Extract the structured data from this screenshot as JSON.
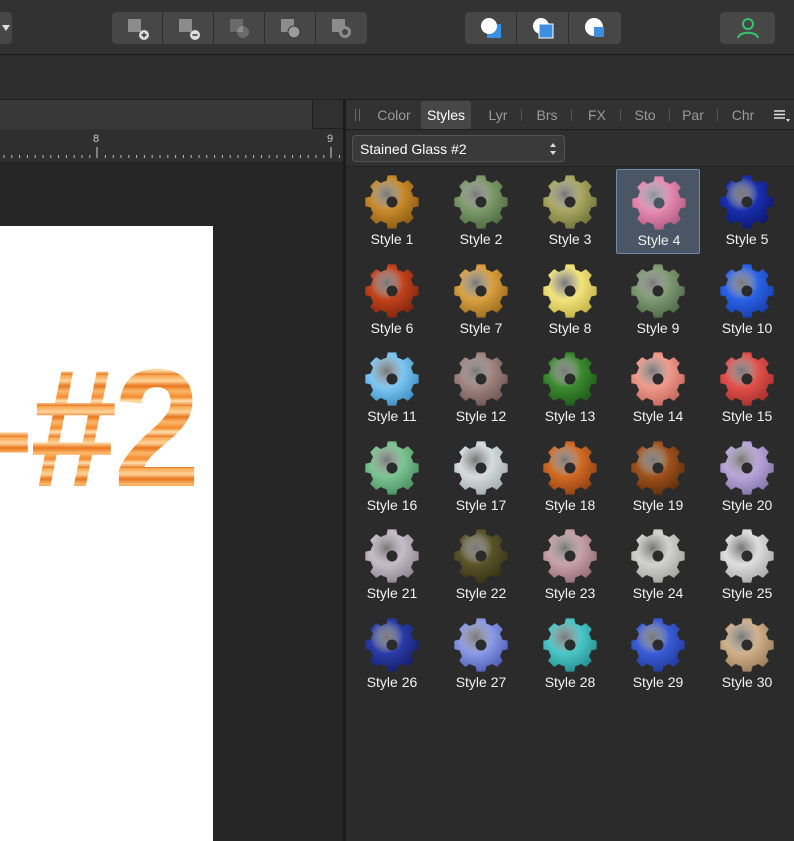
{
  "toolbar": {
    "boolean_ops": [
      "add",
      "subtract",
      "intersect",
      "divide",
      "combine"
    ],
    "shape_ops": [
      "back",
      "front",
      "cut"
    ]
  },
  "ruler": {
    "labels": [
      "8",
      "9"
    ]
  },
  "document": {
    "text": "-#2"
  },
  "panel": {
    "tabs": [
      "Color",
      "Styles",
      "Lyr",
      "Brs",
      "FX",
      "Sto",
      "Par",
      "Chr"
    ],
    "active_tab": "Styles",
    "category": "Stained Glass #2",
    "selected_style": "Style 4",
    "styles": [
      {
        "label": "Style 1",
        "color": "#c98a2a",
        "dark": "#8a5a14"
      },
      {
        "label": "Style 2",
        "color": "#7c9a6a",
        "dark": "#4e6a40"
      },
      {
        "label": "Style 3",
        "color": "#a9a862",
        "dark": "#6f7038"
      },
      {
        "label": "Style 4",
        "color": "#e58ab0",
        "dark": "#b05a80"
      },
      {
        "label": "Style 5",
        "color": "#1a2fb0",
        "dark": "#0c1670"
      },
      {
        "label": "Style 6",
        "color": "#c2421c",
        "dark": "#7e2410"
      },
      {
        "label": "Style 7",
        "color": "#d9a040",
        "dark": "#9a6a1e"
      },
      {
        "label": "Style 8",
        "color": "#f2e37a",
        "dark": "#c0b048"
      },
      {
        "label": "Style 9",
        "color": "#7e9a72",
        "dark": "#4e6848"
      },
      {
        "label": "Style 10",
        "color": "#2a62e8",
        "dark": "#173ea8"
      },
      {
        "label": "Style 11",
        "color": "#7cc6f2",
        "dark": "#3e8ec0"
      },
      {
        "label": "Style 12",
        "color": "#a08480",
        "dark": "#6e5652"
      },
      {
        "label": "Style 13",
        "color": "#3c8a30",
        "dark": "#1f5a18"
      },
      {
        "label": "Style 14",
        "color": "#f09a8a",
        "dark": "#c0685a"
      },
      {
        "label": "Style 15",
        "color": "#e2504a",
        "dark": "#a8302c"
      },
      {
        "label": "Style 16",
        "color": "#7cc492",
        "dark": "#4a8e60"
      },
      {
        "label": "Style 17",
        "color": "#d6dcdc",
        "dark": "#a2aaaa"
      },
      {
        "label": "Style 18",
        "color": "#d26a24",
        "dark": "#8e4012"
      },
      {
        "label": "Style 19",
        "color": "#a0521c",
        "dark": "#5e2e0c"
      },
      {
        "label": "Style 20",
        "color": "#b8a6d8",
        "dark": "#8474a8"
      },
      {
        "label": "Style 21",
        "color": "#c6bcc6",
        "dark": "#8e848e"
      },
      {
        "label": "Style 22",
        "color": "#5a5428",
        "dark": "#363214"
      },
      {
        "label": "Style 23",
        "color": "#c6a0aa",
        "dark": "#946c78"
      },
      {
        "label": "Style 24",
        "color": "#d2d2d0",
        "dark": "#a0a09e"
      },
      {
        "label": "Style 25",
        "color": "#dedede",
        "dark": "#a8a8a8"
      },
      {
        "label": "Style 26",
        "color": "#2a3ca8",
        "dark": "#141e68"
      },
      {
        "label": "Style 27",
        "color": "#8a9ae6",
        "dark": "#4c5cb6"
      },
      {
        "label": "Style 28",
        "color": "#4ac6c6",
        "dark": "#268e90"
      },
      {
        "label": "Style 29",
        "color": "#3a5cd6",
        "dark": "#203a9a"
      },
      {
        "label": "Style 30",
        "color": "#cfb08a",
        "dark": "#9a7c58"
      }
    ]
  },
  "accent": "#35c46a"
}
